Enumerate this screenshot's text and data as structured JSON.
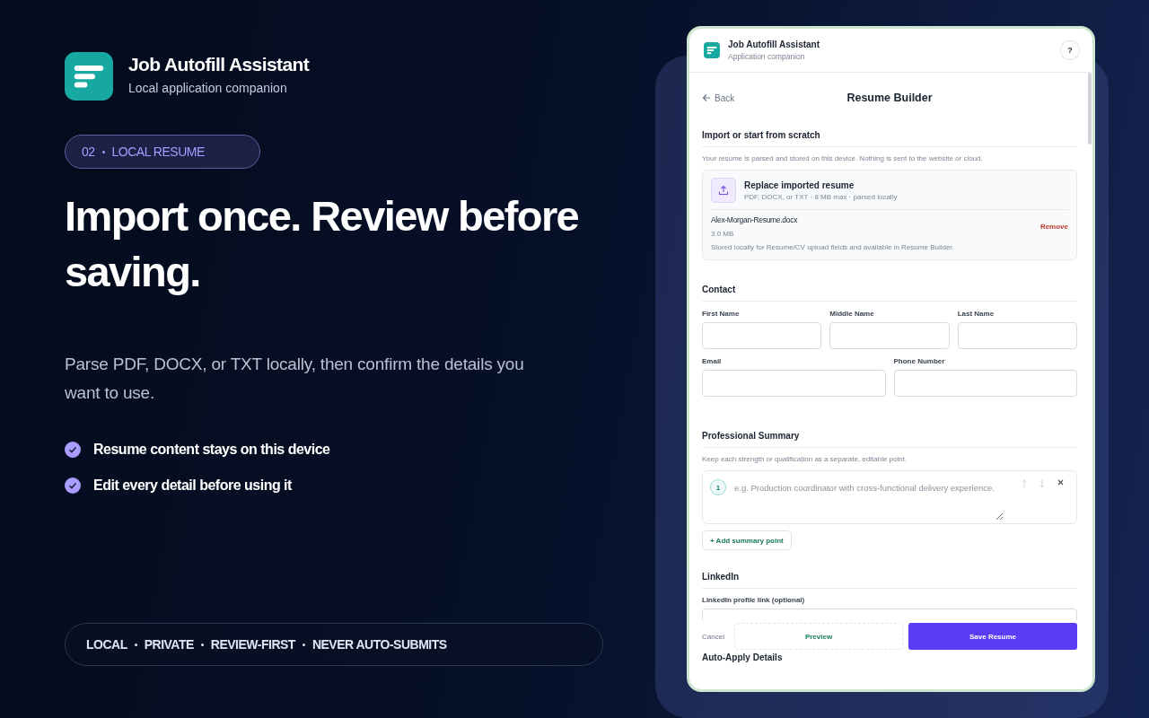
{
  "brand": {
    "title": "Job Autofill Assistant",
    "subtitle": "Local application companion"
  },
  "badge": {
    "number": "02",
    "label": "LOCAL RESUME"
  },
  "headline": "Import once. Review before saving.",
  "description": "Parse PDF, DOCX, or TXT locally, then confirm the details you want to use.",
  "features": [
    "Resume content stays on this device",
    "Edit every detail before using it"
  ],
  "tags": [
    "LOCAL",
    "PRIVATE",
    "REVIEW-FIRST",
    "NEVER AUTO-SUBMITS"
  ],
  "app": {
    "header": {
      "title": "Job Autofill Assistant",
      "subtitle": "Application companion",
      "help": "?"
    },
    "back": "Back",
    "page_title": "Resume Builder",
    "import": {
      "heading": "Import or start from scratch",
      "note": "Your resume is parsed and stored on this device. Nothing is sent to the website or cloud.",
      "upload_title": "Replace imported resume",
      "upload_hint": "PDF, DOCX, or TXT · 8 MB max · parsed locally",
      "file_name": "Alex-Morgan-Resume.docx",
      "file_size": "3.0 MB",
      "remove": "Remove",
      "file_note": "Stored locally for Resume/CV upload fields and available in Resume Builder."
    },
    "contact": {
      "heading": "Contact",
      "rows": [
        [
          {
            "label": "First Name"
          },
          {
            "label": "Middle Name"
          },
          {
            "label": "Last Name"
          }
        ],
        [
          {
            "label": "Email"
          },
          {
            "label": "Phone Number"
          }
        ]
      ]
    },
    "summary": {
      "heading": "Professional Summary",
      "note": "Keep each strength or qualification as a separate, editable point.",
      "points": [
        {
          "number": "1",
          "placeholder": "e.g. Production coordinator with cross-functional delivery experience."
        }
      ],
      "add": "+ Add summary point"
    },
    "linkedin": {
      "heading": "LinkedIn",
      "label": "LinkedIn profile link (optional)"
    },
    "footer": {
      "cancel": "Cancel",
      "preview": "Preview",
      "save": "Save Resume"
    },
    "next_heading": "Auto-Apply Details"
  }
}
